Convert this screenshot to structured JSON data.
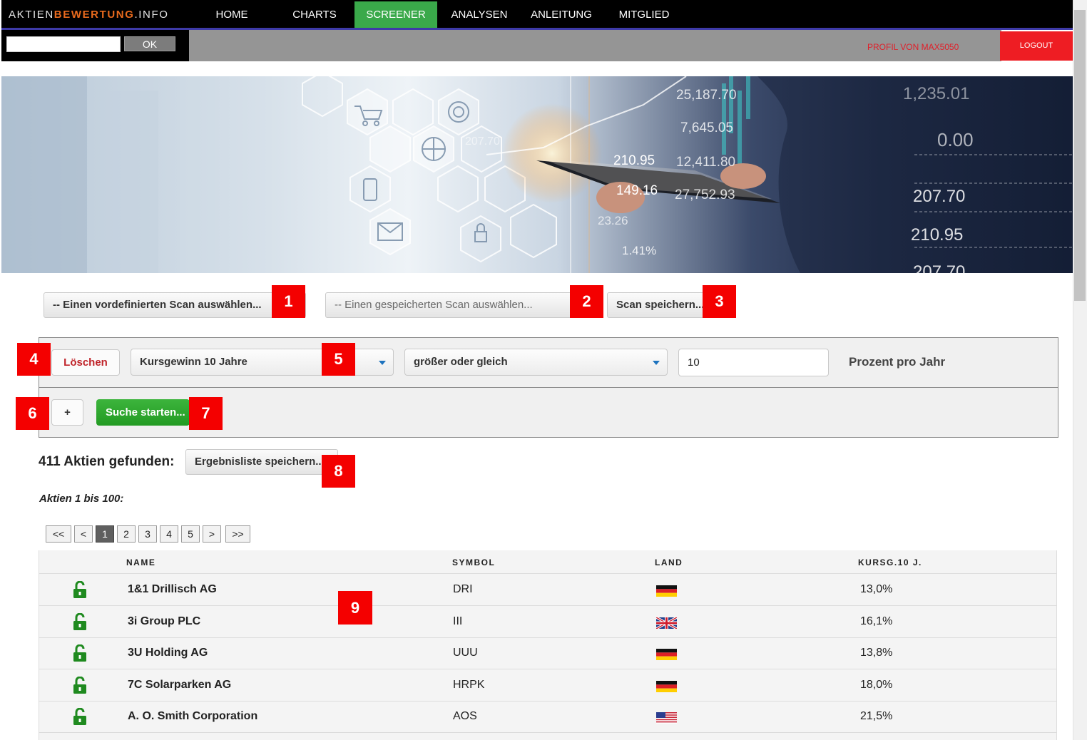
{
  "logo": {
    "part1": "AKTIEN",
    "part2": "BEWERTUNG",
    "part3": ".INFO"
  },
  "nav": [
    {
      "label": "HOME"
    },
    {
      "label": "CHARTS"
    },
    {
      "label": "SCREENER"
    },
    {
      "label": "ANALYSEN"
    },
    {
      "label": "ANLEITUNG"
    },
    {
      "label": "MITGLIED"
    }
  ],
  "nav_active": "SCREENER",
  "search": {
    "value": "",
    "ok_label": "OK"
  },
  "profile_label": "PROFIL VON MAX5050",
  "logout_label": "LOGOUT",
  "hero_numbers": {
    "n1": "25,187.70",
    "n2": "7,645.05",
    "n3": "210.95",
    "n4": "12,411.80",
    "n5": "149.16",
    "n6": "27,752.93",
    "n7": "23.26",
    "n8": "1.41%",
    "n9": "1,235.01",
    "n10": "0.00",
    "n11": "207.70",
    "n12": "210.95",
    "n13": "207.70",
    "n14": "207.70"
  },
  "scan": {
    "predefined": "-- Einen vordefinierten Scan auswählen...",
    "saved": "-- Einen gespeicherten Scan auswählen...",
    "save_scan": "Scan speichern..."
  },
  "filter": {
    "delete_label": "Löschen",
    "criterion": "Kursgewinn 10 Jahre",
    "operator": "größer oder gleich",
    "value": "10",
    "unit": "Prozent pro Jahr",
    "add_label": "+",
    "start_label": "Suche starten..."
  },
  "results": {
    "found": "411 Aktien gefunden:",
    "save_list": "Ergebnisliste speichern...",
    "range": "Aktien 1 bis 100:"
  },
  "pager": [
    "<<",
    "<",
    "1",
    "2",
    "3",
    "4",
    "5",
    ">",
    ">>"
  ],
  "pager_current": "1",
  "table": {
    "headers": {
      "name": "NAME",
      "symbol": "SYMBOL",
      "land": "LAND",
      "kursg": "KURSG.10 J."
    },
    "rows": [
      {
        "name": "1&1 Drillisch AG",
        "symbol": "DRI",
        "flag": "de",
        "kursg": "13,0%"
      },
      {
        "name": "3i Group PLC",
        "symbol": "III",
        "flag": "gb",
        "kursg": "16,1%"
      },
      {
        "name": "3U Holding AG",
        "symbol": "UUU",
        "flag": "de",
        "kursg": "13,8%"
      },
      {
        "name": "7C Solarparken AG",
        "symbol": "HRPK",
        "flag": "de",
        "kursg": "18,0%"
      },
      {
        "name": "A. O. Smith Corporation",
        "symbol": "AOS",
        "flag": "us",
        "kursg": "21,5%"
      }
    ]
  },
  "markers": [
    "1",
    "2",
    "3",
    "4",
    "5",
    "6",
    "7",
    "8",
    "9"
  ],
  "colors": {
    "active_nav": "#3aa94a",
    "marker": "#f40000",
    "logout": "#ee1d23",
    "lock": "#1f8a1f"
  }
}
